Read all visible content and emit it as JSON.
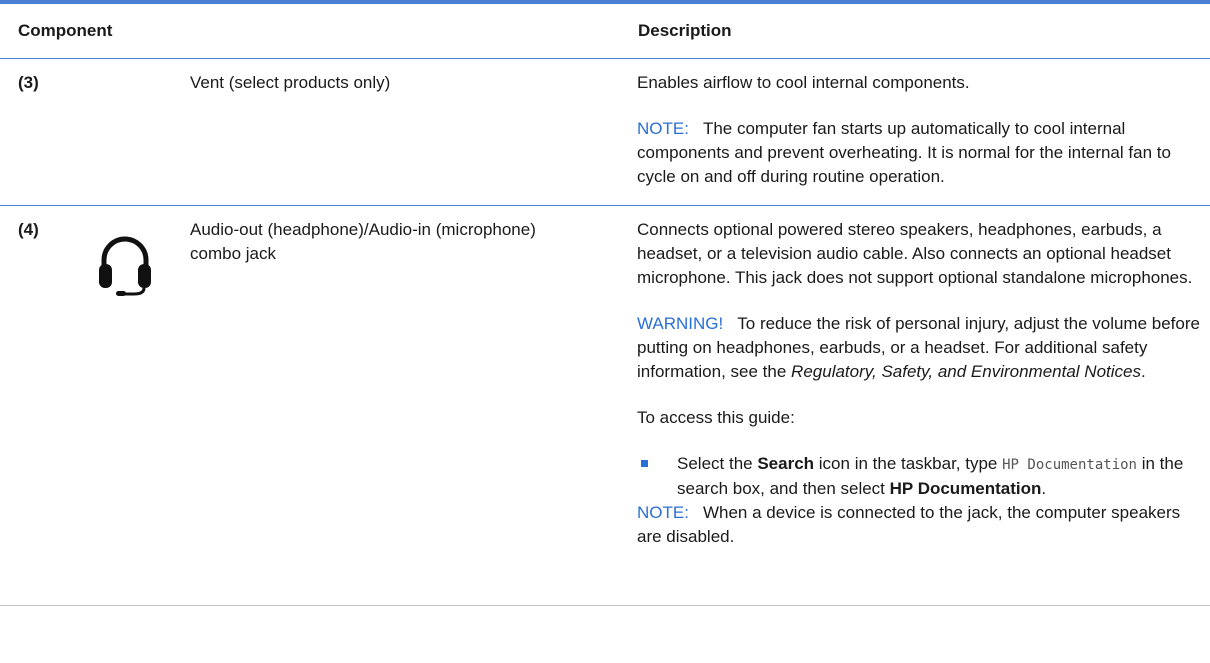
{
  "header": {
    "component": "Component",
    "description": "Description"
  },
  "rows": [
    {
      "number": "(3)",
      "name": "Vent (select products only)",
      "desc_main": "Enables airflow to cool internal components.",
      "note_label": "NOTE:",
      "note_text": "The computer fan starts up automatically to cool internal components and prevent overheating. It is normal for the internal fan to cycle on and off during routine operation."
    },
    {
      "number": "(4)",
      "icon": "headphone-icon",
      "name": "Audio-out (headphone)/Audio-in (microphone) combo jack",
      "desc_main": "Connects optional powered stereo speakers, headphones, earbuds, a headset, or a television audio cable. Also connects an optional headset microphone. This jack does not support optional standalone microphones.",
      "warning_label": "WARNING!",
      "warning_text": "To reduce the risk of personal injury, adjust the volume before putting on headphones, earbuds, or a headset. For additional safety information, see the",
      "warning_doc": "Regulatory, Safety, and Environmental Notices",
      "warning_end": ".",
      "access_text": "To access this guide:",
      "bullet_pre": "Select the",
      "bullet_search": "Search",
      "bullet_mid": "icon in the taskbar, type",
      "bullet_code": "HP Documentation",
      "bullet_post": "in the search box, and then select",
      "bullet_target": "HP Documentation",
      "bullet_end": ".",
      "note_label": "NOTE:",
      "note_text": "When a device is connected to the jack, the computer speakers are disabled."
    }
  ],
  "colors": {
    "accent": "#2a6fd6",
    "rule": "#4a7fd4"
  }
}
